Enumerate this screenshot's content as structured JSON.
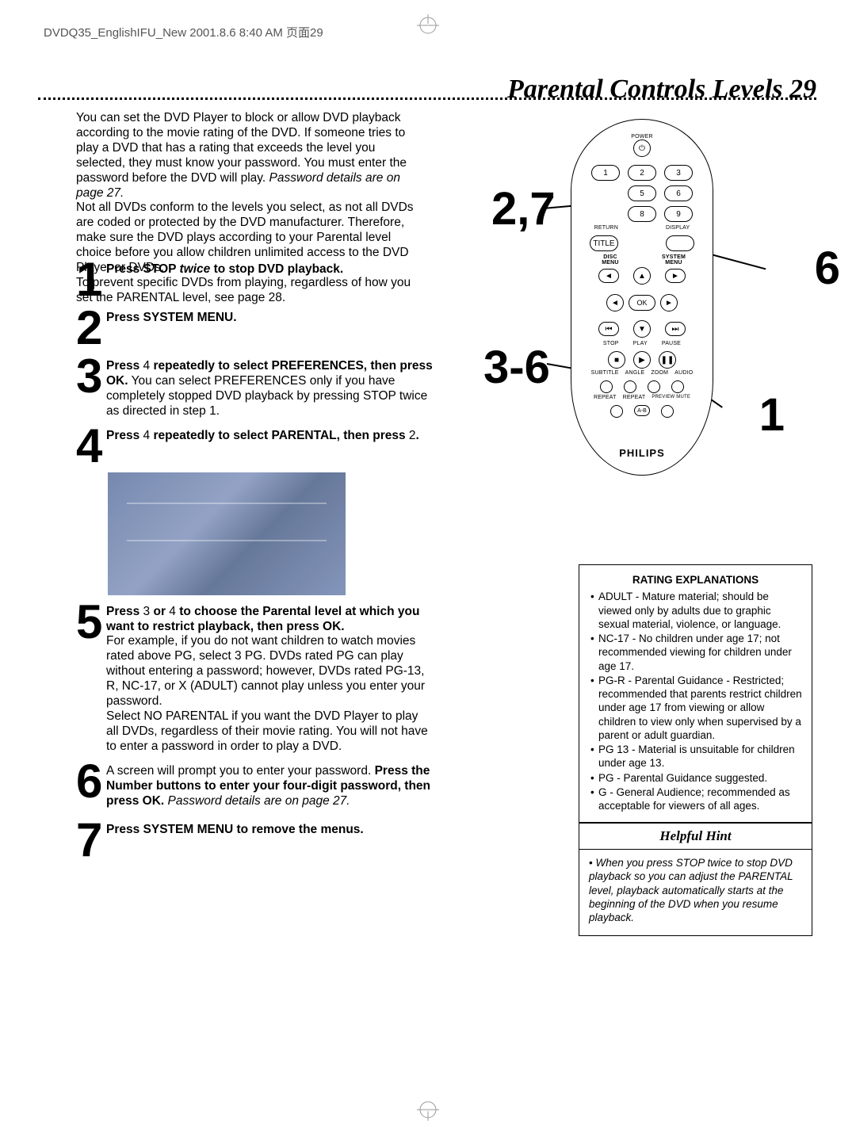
{
  "meta_header": "DVDQ35_EnglishIFU_New  2001.8.6 8:40 AM  页面29",
  "page_title": "Parental Controls Levels  29",
  "intro": {
    "p1": "You can set the DVD Player to block or allow DVD playback according to the movie rating of the DVD. If someone tries to play a DVD that has a rating that exceeds the level you selected, they must know your password. You must enter the password before the DVD will play. ",
    "p1_i": "Password details are on page 27.",
    "p2": "Not all DVDs conform to the levels you select, as not all DVDs are coded or protected by the DVD manufacturer. Therefore, make sure the DVD plays according to your Parental level choice before you allow children unlimited access to the DVD Player or DVDs.",
    "p3": "To prevent specific DVDs from playing, regardless of how you set the PARENTAL level, see page 28."
  },
  "steps": {
    "s1": {
      "num": "1",
      "a": "Press STOP ",
      "i": "twice",
      "b": " to stop DVD playback."
    },
    "s2": {
      "num": "2",
      "a": "Press SYSTEM MENU."
    },
    "s3": {
      "num": "3",
      "a": "Press ",
      "k1": "4",
      "b": "  repeatedly to select PREFERENCES, then press OK.",
      "c": " You can select PREFERENCES only if you have completely stopped DVD playback by pressing STOP twice as directed in step 1."
    },
    "s4": {
      "num": "4",
      "a": "Press ",
      "k1": "4",
      "b": "  repeatedly to select PARENTAL, then press ",
      "k2": "2",
      "c": "."
    },
    "s5": {
      "num": "5",
      "a": "Press ",
      "k1": "3",
      "or": " or ",
      "k2": "4",
      "b": "  to choose the Parental level at which you want to restrict playback, then press OK.",
      "p1": "For example, if you do not want children to watch movies rated above PG, select 3 PG. DVDs rated PG can play without entering a password; however, DVDs rated PG-13, R, NC-17, or X (ADULT) cannot play unless you enter your password.",
      "p2": "Select NO PARENTAL if you want the DVD Player to play all DVDs, regardless of their movie rating. You will not have to enter a password in order to play a DVD."
    },
    "s6": {
      "num": "6",
      "a": "A screen will prompt you to enter your password. ",
      "b": "Press the Number buttons to enter your four-digit password, then press OK.",
      "i": " Password details are on page 27."
    },
    "s7": {
      "num": "7",
      "a": "Press SYSTEM MENU to remove the menus."
    }
  },
  "remote": {
    "power": "POWER",
    "return": "RETURN",
    "display": "DISPLAY",
    "title": "TITLE",
    "disc_menu": "DISC MENU",
    "system_menu": "SYSTEM MENU",
    "ok": "OK",
    "stop": "STOP",
    "play": "PLAY",
    "pause": "PAUSE",
    "subtitle": "SUBTITLE",
    "angle": "ANGLE",
    "zoom": "ZOOM",
    "audio": "AUDIO",
    "repeat": "REPEAT",
    "repeat2": "REPEAT",
    "preview_mute": "PREVIEW MUTE",
    "ab": "A-B",
    "brand": "PHILIPS",
    "keys": {
      "k1": "1",
      "k2": "2",
      "k3": "3",
      "k5": "5",
      "k6": "6",
      "k8": "8",
      "k9": "9"
    }
  },
  "callouts": {
    "c27": "2,7",
    "c36": "3-6",
    "c6": "6",
    "c1": "1"
  },
  "rating": {
    "title": "RATING EXPLANATIONS",
    "items": [
      "ADULT - Mature material; should be viewed only by adults due to graphic sexual material, violence, or language.",
      "NC-17 - No children under age 17; not recommended viewing for children under age 17.",
      "PG-R - Parental Guidance - Restricted; recommended that parents restrict children under age 17 from viewing or allow children to view only when supervised by a parent or adult guardian.",
      "PG 13 - Material is unsuitable for children under age 13.",
      "PG - Parental Guidance suggested.",
      "G - General Audience; recommended as acceptable for viewers of all ages."
    ]
  },
  "hint": {
    "title": "Helpful Hint",
    "body": "When you press STOP twice to stop DVD playback so you can adjust the PARENTAL level, playback automatically starts at the beginning of the DVD when you resume playback."
  }
}
